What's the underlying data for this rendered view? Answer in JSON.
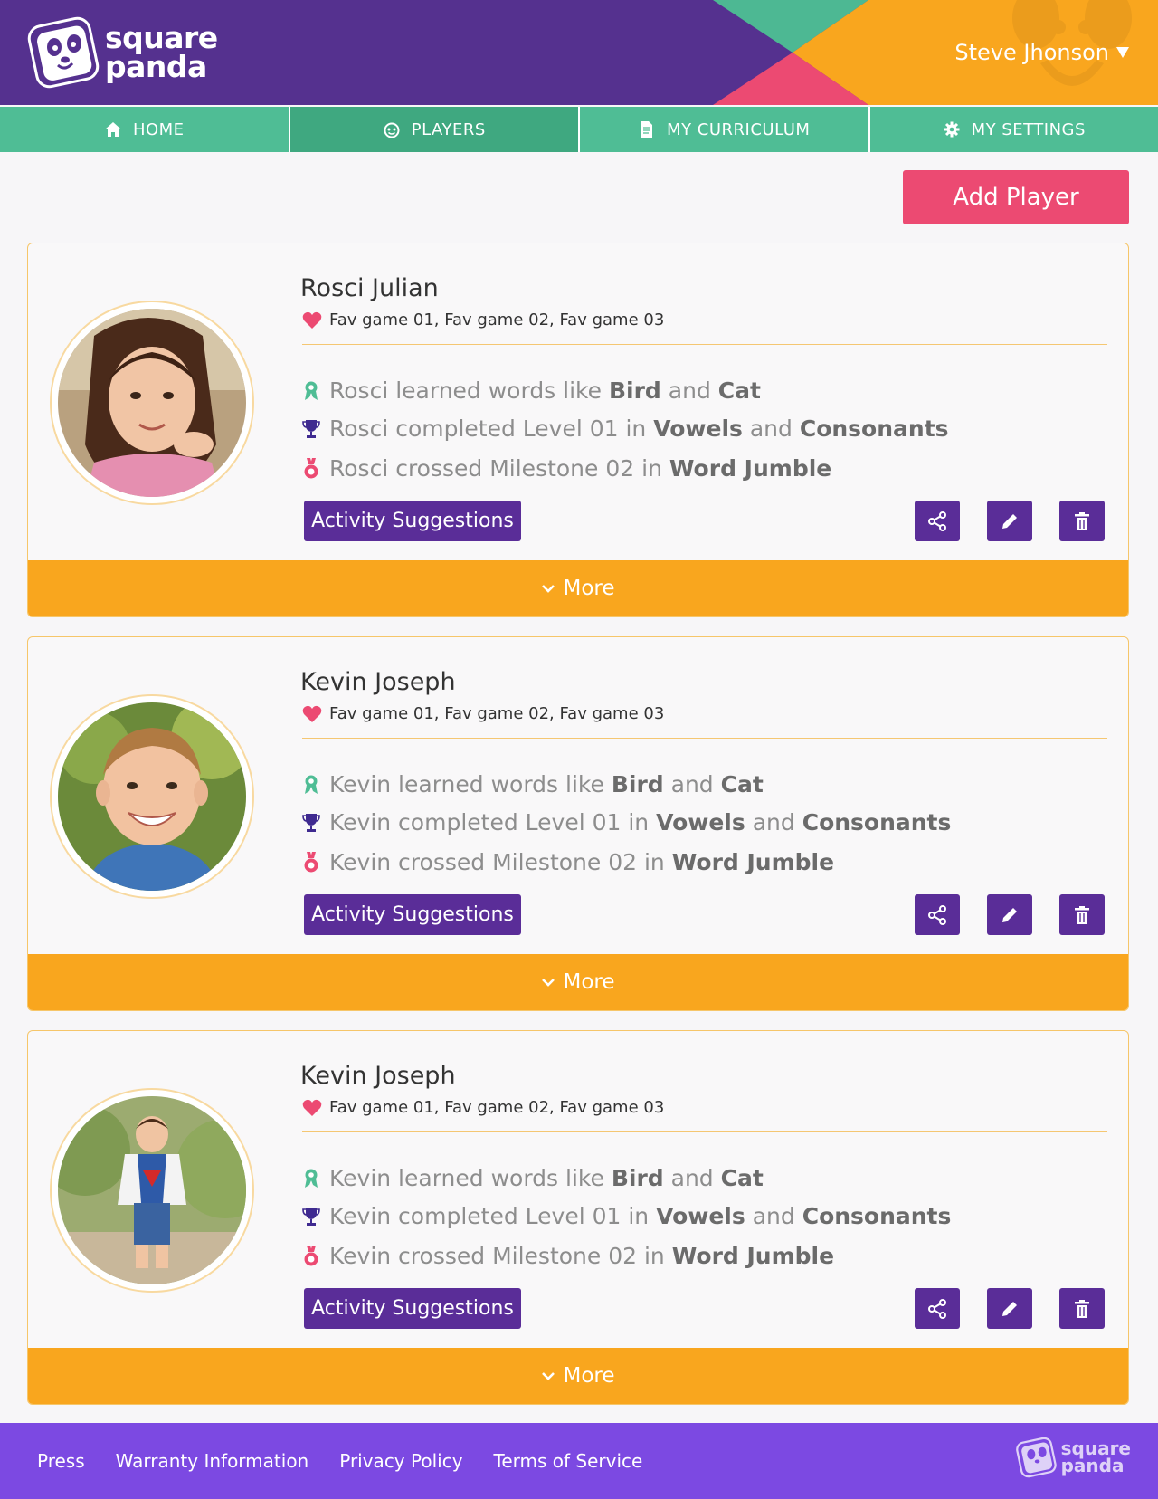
{
  "app": {
    "brand": {
      "line1": "square",
      "line2": "panda"
    },
    "user_name": "Steve Jhonson"
  },
  "colors": {
    "header_purple": "#55318f",
    "nav_green": "#4fbd95",
    "accent_pink": "#ec4a72",
    "orange": "#f9a61e",
    "button_purple": "#5a2d98",
    "footer_purple": "#7c49e2"
  },
  "nav": {
    "items": [
      {
        "label": "HOME",
        "icon": "home-icon"
      },
      {
        "label": "PLAYERS",
        "icon": "players-icon",
        "active": true
      },
      {
        "label": "MY CURRICULUM",
        "icon": "document-icon"
      },
      {
        "label": "MY SETTINGS",
        "icon": "gear-icon"
      }
    ]
  },
  "actions": {
    "add_player": "Add Player"
  },
  "players": [
    {
      "name": "Rosci Julian",
      "favorites": "Fav game 01, Fav game 02, Fav game 03",
      "stats": {
        "learned": {
          "prefix": "Rosci learned words like ",
          "word1": "Bird",
          "mid": " and ",
          "word2": "Cat"
        },
        "completed": {
          "prefix": "Rosci completed Level 01 in ",
          "word1": "Vowels",
          "mid": " and ",
          "word2": "Consonants"
        },
        "milestone": {
          "prefix": "Rosci crossed Milestone 02 in ",
          "word1": "Word Jumble"
        }
      },
      "activity_label": "Activity Suggestions",
      "more_label": "More"
    },
    {
      "name": "Kevin Joseph",
      "favorites": "Fav game 01, Fav game 02, Fav game 03",
      "stats": {
        "learned": {
          "prefix": "Kevin learned words like ",
          "word1": "Bird",
          "mid": " and ",
          "word2": "Cat"
        },
        "completed": {
          "prefix": "Kevin completed Level 01 in ",
          "word1": "Vowels",
          "mid": " and ",
          "word2": "Consonants"
        },
        "milestone": {
          "prefix": "Kevin crossed Milestone 02 in ",
          "word1": "Word Jumble"
        }
      },
      "activity_label": "Activity Suggestions",
      "more_label": "More"
    },
    {
      "name": "Kevin Joseph",
      "favorites": "Fav game 01, Fav game 02, Fav game 03",
      "stats": {
        "learned": {
          "prefix": "Kevin learned words like ",
          "word1": "Bird",
          "mid": " and ",
          "word2": "Cat"
        },
        "completed": {
          "prefix": "Kevin completed Level 01 in ",
          "word1": "Vowels",
          "mid": " and ",
          "word2": "Consonants"
        },
        "milestone": {
          "prefix": "Kevin crossed Milestone 02 in ",
          "word1": "Word Jumble"
        }
      },
      "activity_label": "Activity Suggestions",
      "more_label": "More"
    }
  ],
  "footer": {
    "links": [
      "Press",
      "Warranty Information",
      "Privacy Policy",
      "Terms of Service"
    ],
    "brand": {
      "line1": "square",
      "line2": "panda"
    }
  }
}
